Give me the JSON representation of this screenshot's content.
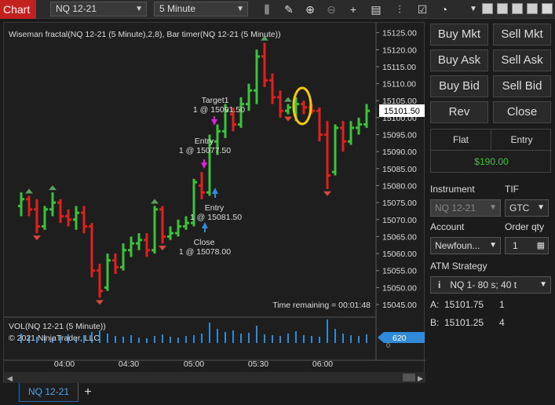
{
  "toolbar": {
    "chart_tab": "Chart",
    "instrument": "NQ 12-21",
    "interval": "5 Minute"
  },
  "chart": {
    "indicator_title": "Wiseman fractal(NQ 12-21 (5 Minute),2,8), Bar timer(NQ 12-21 (5 Minute))",
    "time_remaining": "Time remaining = 00:01:48",
    "price_ticks": [
      "15125.00",
      "15120.00",
      "15115.00",
      "15110.00",
      "15105.00",
      "15100.00",
      "15095.00",
      "15090.00",
      "15085.00",
      "15080.00",
      "15075.00",
      "15070.00",
      "15065.00",
      "15060.00",
      "15055.00",
      "15050.00",
      "15045.00"
    ],
    "current_price": "15101.50",
    "time_ticks": [
      "04:00",
      "04:30",
      "05:00",
      "05:30",
      "06:00"
    ],
    "annotations": {
      "target1_title": "Target1",
      "target1_detail": "1 @ 15091.50",
      "entry_short_title": "Entry",
      "entry_short_detail": "1 @ 15077.50",
      "entry_long_title": "Entry",
      "entry_long_detail": "1 @ 15081.50",
      "close_title": "Close",
      "close_detail": "1 @ 15078.00"
    },
    "vol_title": "VOL(NQ 12-21 (5 Minute))",
    "copyright": "© 2021 NinjaTrader, LLC",
    "vol_current": "620",
    "vol_ticks": [
      "0"
    ],
    "colors": {
      "up": "#3cc33c",
      "down": "#e0201e",
      "vol": "#2f8bd8",
      "fractal_up": "#5aa05a",
      "fractal_down": "#d64a3a",
      "highlight": "#f5c518"
    }
  },
  "bottom": {
    "tab_label": "NQ 12-21",
    "add_label": "+"
  },
  "panel": {
    "buy_mkt": "Buy Mkt",
    "sell_mkt": "Sell Mkt",
    "buy_ask": "Buy Ask",
    "sell_ask": "Sell Ask",
    "buy_bid": "Buy Bid",
    "sell_bid": "Sell Bid",
    "rev": "Rev",
    "close": "Close",
    "position_label": "Flat",
    "entry_label": "Entry",
    "pnl": "$190.00",
    "instrument_label": "Instrument",
    "instrument_value": "NQ 12-21",
    "tif_label": "TIF",
    "tif_value": "GTC",
    "account_label": "Account",
    "account_value": "Newfoun...",
    "order_qty_label": "Order qty",
    "order_qty_value": "1",
    "atm_label": "ATM Strategy",
    "atm_value": "NQ 1- 80 s; 40 t",
    "ask_label": "A:",
    "ask_price": "15101.75",
    "ask_size": "1",
    "bid_label": "B:",
    "bid_price": "15101.25",
    "bid_size": "4"
  },
  "chart_data": {
    "type": "ohlc-bar",
    "instrument": "NQ 12-21",
    "interval": "5 Minute",
    "ylim": [
      15042,
      15127
    ],
    "bars": [
      {
        "o": 15074,
        "h": 15078,
        "l": 15071,
        "c": 15076
      },
      {
        "o": 15076,
        "h": 15077,
        "l": 15071,
        "c": 15073
      },
      {
        "o": 15073,
        "h": 15076,
        "l": 15066,
        "c": 15068
      },
      {
        "o": 15068,
        "h": 15074,
        "l": 15067,
        "c": 15073
      },
      {
        "o": 15073,
        "h": 15078,
        "l": 15071,
        "c": 15075
      },
      {
        "o": 15075,
        "h": 15076,
        "l": 15069,
        "c": 15071
      },
      {
        "o": 15071,
        "h": 15073,
        "l": 15068,
        "c": 15070
      },
      {
        "o": 15070,
        "h": 15074,
        "l": 15067,
        "c": 15072
      },
      {
        "o": 15072,
        "h": 15074,
        "l": 15066,
        "c": 15068
      },
      {
        "o": 15068,
        "h": 15069,
        "l": 15053,
        "c": 15055
      },
      {
        "o": 15055,
        "h": 15057,
        "l": 15047,
        "c": 15049
      },
      {
        "o": 15050,
        "h": 15060,
        "l": 15049,
        "c": 15058
      },
      {
        "o": 15058,
        "h": 15060,
        "l": 15054,
        "c": 15056
      },
      {
        "o": 15056,
        "h": 15063,
        "l": 15055,
        "c": 15061
      },
      {
        "o": 15061,
        "h": 15065,
        "l": 15059,
        "c": 15063
      },
      {
        "o": 15063,
        "h": 15066,
        "l": 15061,
        "c": 15064
      },
      {
        "o": 15064,
        "h": 15066,
        "l": 15059,
        "c": 15061
      },
      {
        "o": 15061,
        "h": 15074,
        "l": 15060,
        "c": 15073
      },
      {
        "o": 15073,
        "h": 15074,
        "l": 15063,
        "c": 15065
      },
      {
        "o": 15065,
        "h": 15068,
        "l": 15064,
        "c": 15066
      },
      {
        "o": 15066,
        "h": 15070,
        "l": 15065,
        "c": 15068
      },
      {
        "o": 15068,
        "h": 15071,
        "l": 15067,
        "c": 15069
      },
      {
        "o": 15069,
        "h": 15082,
        "l": 15068,
        "c": 15081
      },
      {
        "o": 15080,
        "h": 15084,
        "l": 15076,
        "c": 15078
      },
      {
        "o": 15078,
        "h": 15095,
        "l": 15077,
        "c": 15093
      },
      {
        "o": 15093,
        "h": 15098,
        "l": 15089,
        "c": 15096
      },
      {
        "o": 15096,
        "h": 15104,
        "l": 15094,
        "c": 15102
      },
      {
        "o": 15101,
        "h": 15103,
        "l": 15096,
        "c": 15098
      },
      {
        "o": 15098,
        "h": 15106,
        "l": 15097,
        "c": 15104
      },
      {
        "o": 15104,
        "h": 15110,
        "l": 15102,
        "c": 15108
      },
      {
        "o": 15108,
        "h": 15120,
        "l": 15104,
        "c": 15118
      },
      {
        "o": 15118,
        "h": 15122,
        "l": 15109,
        "c": 15111
      },
      {
        "o": 15111,
        "h": 15113,
        "l": 15104,
        "c": 15106
      },
      {
        "o": 15106,
        "h": 15108,
        "l": 15100,
        "c": 15102
      },
      {
        "o": 15102,
        "h": 15104,
        "l": 15101,
        "c": 15103
      },
      {
        "o": 15103,
        "h": 15106,
        "l": 15099,
        "c": 15104
      },
      {
        "o": 15104,
        "h": 15105,
        "l": 15101,
        "c": 15103
      },
      {
        "o": 15103,
        "h": 15104,
        "l": 15101,
        "c": 15102
      },
      {
        "o": 15102,
        "h": 15103,
        "l": 15093,
        "c": 15095
      },
      {
        "o": 15095,
        "h": 15099,
        "l": 15079,
        "c": 15083
      },
      {
        "o": 15084,
        "h": 15098,
        "l": 15083,
        "c": 15097
      },
      {
        "o": 15097,
        "h": 15099,
        "l": 15090,
        "c": 15093
      },
      {
        "o": 15093,
        "h": 15099,
        "l": 15092,
        "c": 15097
      },
      {
        "o": 15097,
        "h": 15100,
        "l": 15095,
        "c": 15098
      },
      {
        "o": 15098,
        "h": 15104,
        "l": 15097,
        "c": 15102
      }
    ],
    "fractals": [
      {
        "bar": 1,
        "dir": "up"
      },
      {
        "bar": 2,
        "dir": "down"
      },
      {
        "bar": 4,
        "dir": "up"
      },
      {
        "bar": 10,
        "dir": "down"
      },
      {
        "bar": 17,
        "dir": "up"
      },
      {
        "bar": 18,
        "dir": "down"
      },
      {
        "bar": 31,
        "dir": "up"
      },
      {
        "bar": 34,
        "dir": "up"
      },
      {
        "bar": 34,
        "dir": "down"
      },
      {
        "bar": 39,
        "dir": "down"
      }
    ],
    "volume": [
      12,
      9,
      8,
      10,
      7,
      9,
      11,
      6,
      10,
      14,
      16,
      12,
      9,
      8,
      10,
      7,
      6,
      9,
      11,
      8,
      7,
      9,
      10,
      12,
      26,
      18,
      14,
      16,
      12,
      13,
      22,
      11,
      10,
      9,
      12,
      15,
      10,
      9,
      8,
      30,
      18,
      12,
      10,
      9,
      11
    ]
  }
}
